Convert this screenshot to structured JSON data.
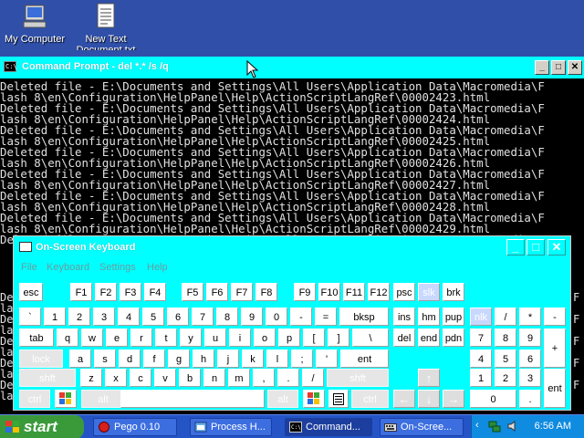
{
  "desktop": {
    "icons": [
      {
        "label": "My Computer",
        "icon": "my-computer-icon"
      },
      {
        "label": "New Text",
        "label2": "Document.txt",
        "icon": "text-document-icon"
      }
    ]
  },
  "cmd": {
    "title": "Command Prompt - del *.* /s /q",
    "lines": [
      "Deleted file - E:\\Documents and Settings\\All Users\\Application Data\\Macromedia\\F",
      "lash 8\\en\\Configuration\\HelpPanel\\Help\\ActionScriptLangRef\\00002423.html",
      "Deleted file - E:\\Documents and Settings\\All Users\\Application Data\\Macromedia\\F",
      "lash 8\\en\\Configuration\\HelpPanel\\Help\\ActionScriptLangRef\\00002424.html",
      "Deleted file - E:\\Documents and Settings\\All Users\\Application Data\\Macromedia\\F",
      "lash 8\\en\\Configuration\\HelpPanel\\Help\\ActionScriptLangRef\\00002425.html",
      "Deleted file - E:\\Documents and Settings\\All Users\\Application Data\\Macromedia\\F",
      "lash 8\\en\\Configuration\\HelpPanel\\Help\\ActionScriptLangRef\\00002426.html",
      "Deleted file - E:\\Documents and Settings\\All Users\\Application Data\\Macromedia\\F",
      "lash 8\\en\\Configuration\\HelpPanel\\Help\\ActionScriptLangRef\\00002427.html",
      "Deleted file - E:\\Documents and Settings\\All Users\\Application Data\\Macromedia\\F",
      "lash 8\\en\\Configuration\\HelpPanel\\Help\\ActionScriptLangRef\\00002428.html",
      "Deleted file - E:\\Documents and Settings\\All Users\\Application Data\\Macromedia\\F",
      "lash 8\\en\\Configuration\\HelpPanel\\Help\\ActionScriptLangRef\\00002429.html",
      "Deleted file - E:\\Documents and Settings\\All Users\\Application Data\\Macromedia\\F"
    ],
    "left_strip": [
      "De",
      "la",
      "De",
      "la",
      "De",
      "la",
      "De",
      "la",
      "De",
      "la"
    ],
    "right_strip": [
      "F",
      "",
      "F",
      "",
      "F",
      "",
      "F",
      "",
      "F",
      ""
    ]
  },
  "osk": {
    "title": "On-Screen Keyboard",
    "menu": [
      "File",
      "Keyboard",
      "Settings",
      "Help"
    ],
    "keys": {
      "esc": "esc",
      "f1": "F1",
      "f2": "F2",
      "f3": "F3",
      "f4": "F4",
      "f5": "F5",
      "f6": "F6",
      "f7": "F7",
      "f8": "F8",
      "f9": "F9",
      "f10": "F10",
      "f11": "F11",
      "f12": "F12",
      "psc": "psc",
      "slk": "slk",
      "brk": "brk",
      "backtick": "`",
      "n1": "1",
      "n2": "2",
      "n3": "3",
      "n4": "4",
      "n5": "5",
      "n6": "6",
      "n7": "7",
      "n8": "8",
      "n9": "9",
      "n0": "0",
      "minus": "-",
      "equals": "=",
      "bksp": "bksp",
      "ins": "ins",
      "hm": "hm",
      "pup": "pup",
      "nlk": "nlk",
      "divide": "/",
      "multiply": "*",
      "numminus": "-",
      "tab": "tab",
      "q": "q",
      "w": "w",
      "e": "e",
      "r": "r",
      "t": "t",
      "y": "y",
      "u": "u",
      "i": "i",
      "o": "o",
      "p": "p",
      "lbracket": "[",
      "rbracket": "]",
      "backslash": "\\",
      "del": "del",
      "end": "end",
      "pdn": "pdn",
      "np7": "7",
      "np8": "8",
      "np9": "9",
      "plus": "+",
      "lock": "lock",
      "a": "a",
      "s": "s",
      "d": "d",
      "f": "f",
      "g": "g",
      "h": "h",
      "j": "j",
      "k": "k",
      "l": "l",
      "semicolon": ";",
      "quote": "'",
      "ent": "ent",
      "np4": "4",
      "np5": "5",
      "np6": "6",
      "lshft": "shft",
      "z": "z",
      "x": "x",
      "c": "c",
      "v": "v",
      "b": "b",
      "n": "n",
      "m": "m",
      "comma": ",",
      "period": ".",
      "slash": "/",
      "rshft": "shft",
      "up": "↑",
      "np1": "1",
      "np2": "2",
      "np3": "3",
      "npent": "ent",
      "lctrl": "ctrl",
      "lalt": "alt",
      "ralt": "alt",
      "rctrl": "ctrl",
      "left": "←",
      "down": "↓",
      "right": "→",
      "np0": "0",
      "npdot": "."
    }
  },
  "taskbar": {
    "start_label": "start",
    "buttons": [
      {
        "label": "Pego 0.10",
        "icon": "pego-icon"
      },
      {
        "label": "Process H...",
        "icon": "process-icon"
      },
      {
        "label": "Command...",
        "icon": "command-prompt-icon"
      },
      {
        "label": "On-Scree...",
        "icon": "keyboard-icon"
      }
    ],
    "clock": "6:56 AM"
  },
  "colors": {
    "desktop": "#2f4fa8",
    "title_bar": "#00ffff",
    "console_bg": "#000000",
    "taskbar": "#2554c7",
    "start_button": "#3a9a3a",
    "tray": "#0f8be0"
  }
}
